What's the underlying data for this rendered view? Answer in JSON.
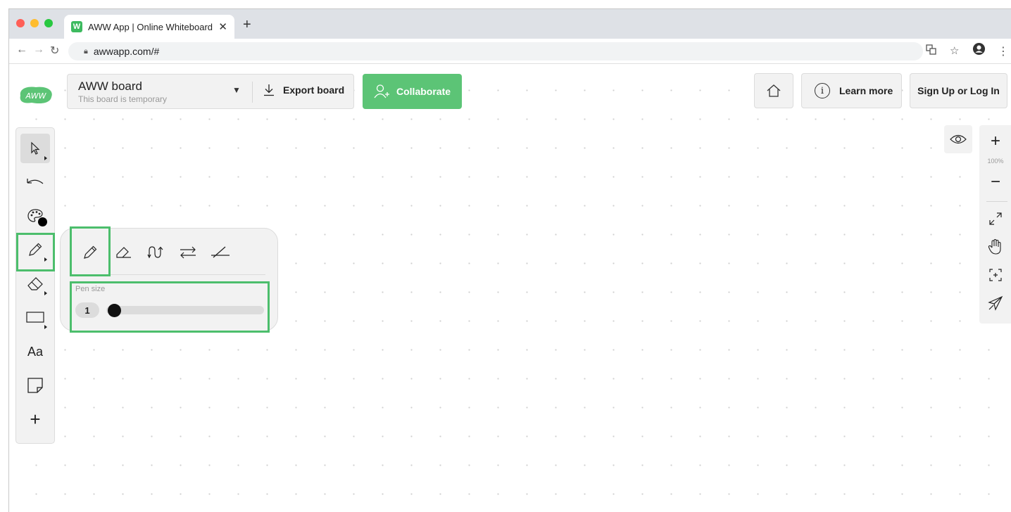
{
  "browser": {
    "tab_title": "AWW App | Online Whiteboard fo",
    "tab_favicon": "W",
    "new_tab": "+",
    "tab_close": "✕",
    "url": "awwapp.com/#"
  },
  "header": {
    "logo_text": "AWW",
    "board_name": "AWW board",
    "board_subtitle": "This board is temporary",
    "export_label": "Export board",
    "collaborate_label": "Collaborate",
    "learn_more_label": "Learn more",
    "signup_label": "Sign Up or Log In",
    "info_glyph": "i"
  },
  "left_toolbar": {
    "tools": [
      {
        "name": "select-tool",
        "icon": "cursor-icon"
      },
      {
        "name": "undo-tool",
        "icon": "undo-icon"
      },
      {
        "name": "color-tool",
        "icon": "palette-icon"
      },
      {
        "name": "pen-tool",
        "icon": "pencil-icon"
      },
      {
        "name": "eraser-tool",
        "icon": "eraser-icon"
      },
      {
        "name": "shape-tool",
        "icon": "rectangle-icon"
      },
      {
        "name": "text-tool",
        "icon": "text-icon",
        "label": "Aa"
      },
      {
        "name": "sticky-note-tool",
        "icon": "sticky-note-icon"
      },
      {
        "name": "add-tool",
        "icon": "plus-icon",
        "label": "+"
      }
    ]
  },
  "pen_panel": {
    "pen_types": [
      "pencil-icon",
      "highlighter-icon",
      "smooth-pen-icon",
      "arrow-pen-icon",
      "line-pen-icon"
    ],
    "size_label": "Pen size",
    "size_value": "1",
    "size_fraction": 0.0
  },
  "zoom_panel": {
    "zoom_in": "+",
    "zoom_level": "100%",
    "zoom_out": "−"
  },
  "colors": {
    "accent": "#5cc476",
    "highlight": "#4cbe6c",
    "panel": "#f2f2f2"
  }
}
